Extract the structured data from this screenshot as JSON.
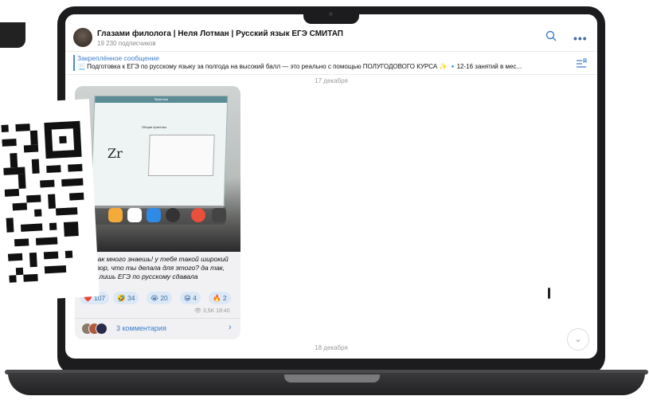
{
  "channel": {
    "title": "Глазами филолога | Неля Лотман | Русский язык ЕГЭ СМИТАП",
    "subscribers": "19 230 подписчиков"
  },
  "header_icons": [
    "search-icon",
    "more-icon"
  ],
  "pinned": {
    "label": "Закреплённое сообщение",
    "text": "📃 Подготовка к ЕГЭ по русскому языку за полгода на высокий балл — это реально с помощью ПОЛУГОДОВОГО КУРСА ✨  🔹12-16 занятий в мес..."
  },
  "feed": {
    "date_top": "17 декабря",
    "date_bottom": "18 декабря"
  },
  "post": {
    "caption": "ты так много знаешь! у тебя такой широкий кругозор, что ты делала для этого? да так, всего лишь ЕГЭ по русскому сдавала",
    "photo": {
      "header": "Практика",
      "section": "Общая практика",
      "element": "Zr"
    },
    "reactions": [
      {
        "emoji": "❤️",
        "count": "107"
      },
      {
        "emoji": "🤣",
        "count": "34"
      },
      {
        "emoji": "😭",
        "count": "20"
      },
      {
        "emoji": "😁",
        "count": "4"
      },
      {
        "emoji": "🔥",
        "count": "2"
      }
    ],
    "views": "👁 3,5K 18:40",
    "comments": "3 комментария"
  },
  "colors": {
    "accent": "#3d7dc9",
    "reaction_bg": "#dce8f6",
    "laptop": "#1c1c1e"
  }
}
